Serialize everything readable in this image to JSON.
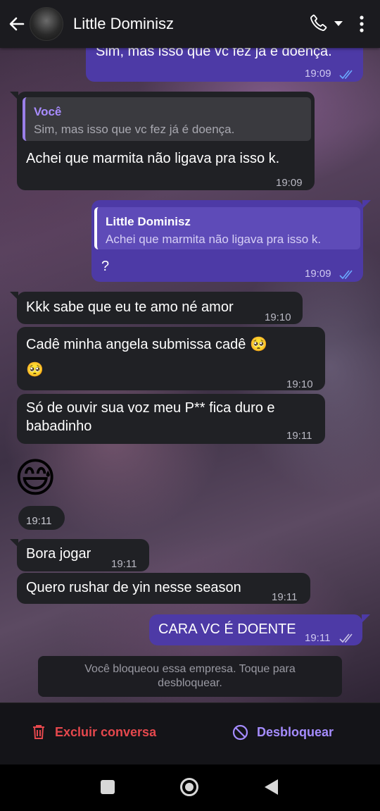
{
  "header": {
    "contact_name": "Little Dominisz",
    "icons": [
      "arrow-left-icon",
      "phone-icon",
      "caret-down-icon",
      "more-vertical-icon"
    ]
  },
  "messages": [
    {
      "dir": "out",
      "text": "Sim, mas isso que vc fez já é doença.",
      "time": "19:09",
      "status": "read"
    },
    {
      "dir": "in",
      "reply_name": "Você",
      "reply_text": "Sim, mas isso que vc fez já é doença.",
      "text": "Achei que marmita não ligava pra isso k.",
      "time": "19:09"
    },
    {
      "dir": "out",
      "reply_name": "Little Dominisz",
      "reply_text": "Achei que marmita não ligava pra isso k.",
      "text": "?",
      "time": "19:09",
      "status": "read"
    },
    {
      "dir": "in",
      "text": "Kkk sabe que eu te amo né amor",
      "time": "19:10"
    },
    {
      "dir": "in",
      "text": "Cadê minha angela submissa cadê 🥺",
      "text2": "🥺",
      "time": "19:10"
    },
    {
      "dir": "in",
      "text": "Só de ouvir sua voz meu P** fica duro e",
      "text2": "babadinho",
      "time": "19:11"
    },
    {
      "dir": "in",
      "emoji": "😅",
      "time": "19:11"
    },
    {
      "dir": "in",
      "text": "Bora jogar",
      "time": "19:11"
    },
    {
      "dir": "in",
      "text": "Quero rushar de yin nesse season",
      "time": "19:11"
    },
    {
      "dir": "out",
      "text": "CARA VC É DOENTE",
      "time": "19:11",
      "status": "delivered"
    }
  ],
  "blocked_notice": {
    "line1": "Você bloqueou essa empresa. Toque para",
    "line2": "desbloquear."
  },
  "actions": {
    "delete_label": "Excluir conversa",
    "unblock_label": "Desbloquear"
  },
  "colors": {
    "header_bg": "#1b1b1f",
    "incoming_bubble": "#202125",
    "outgoing_bubble": "#4d3aa6",
    "delete_red": "#e5484d",
    "unblock_purple": "#a58cff",
    "read_tick": "#6aa9ff"
  },
  "navbar": {
    "icons": [
      "square-recents-icon",
      "circle-home-icon",
      "triangle-back-icon"
    ]
  }
}
